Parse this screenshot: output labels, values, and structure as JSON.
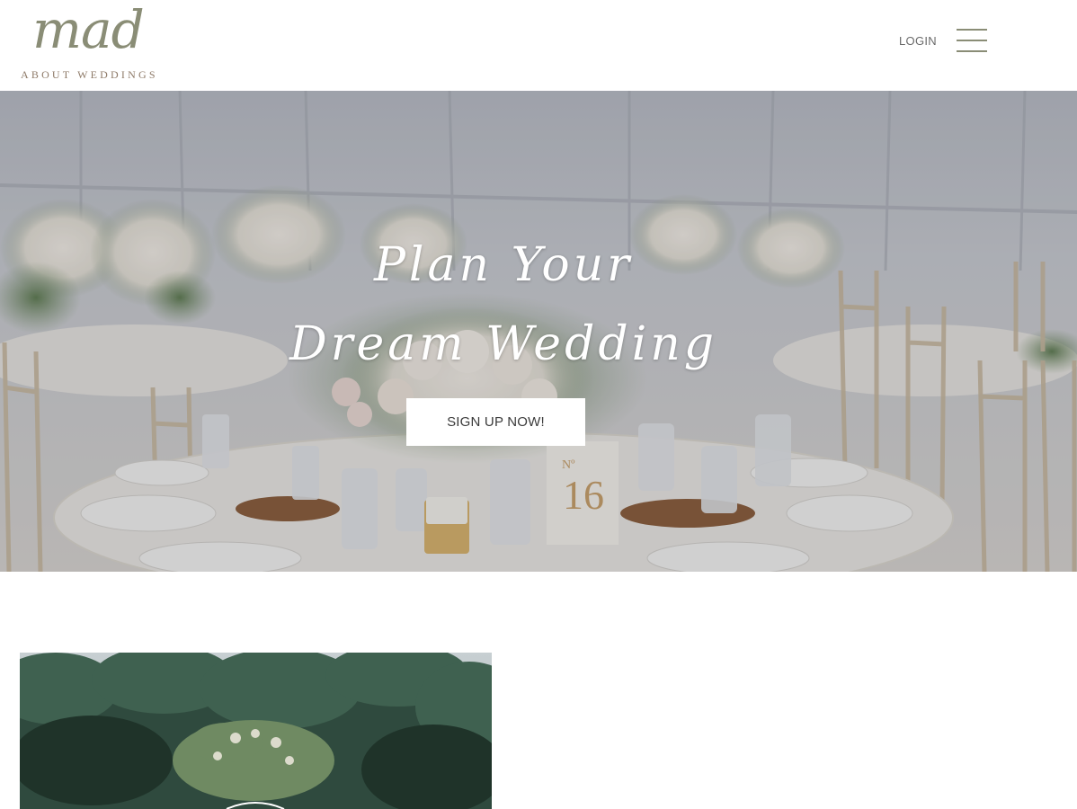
{
  "header": {
    "logo": {
      "script": "mad",
      "tagline": "ABOUT WEDDINGS"
    },
    "login_label": "LOGIN",
    "menu_icon": "hamburger-menu-icon"
  },
  "hero": {
    "heading_line1": "Plan Your",
    "heading_line2": "Dream Wedding",
    "cta_label": "SIGN UP NOW!",
    "image": "wedding-reception-table-photo"
  },
  "content": {
    "feature_image": "tropical-garden-photo"
  },
  "colors": {
    "brand_sage": "#8a8d76",
    "brand_taupe": "#8e7a68",
    "text_gray": "#6a6a6a",
    "white": "#ffffff"
  }
}
